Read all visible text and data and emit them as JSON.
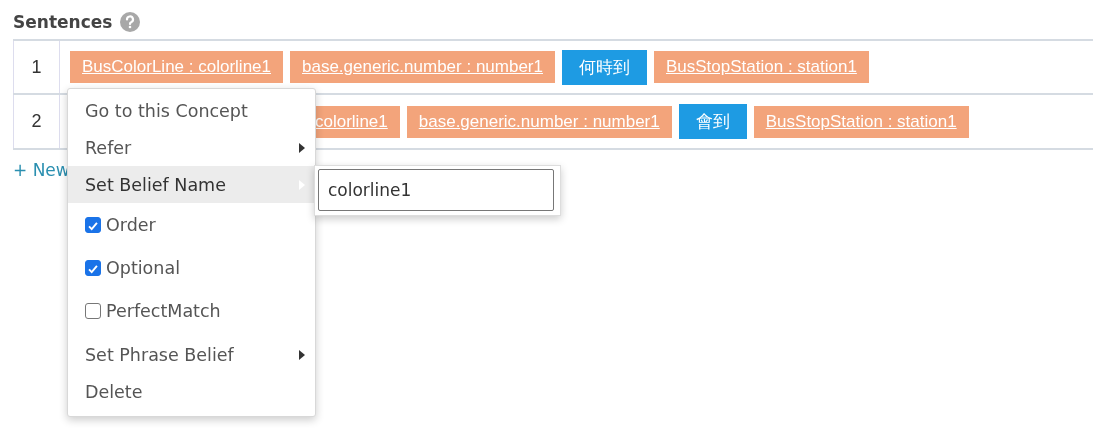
{
  "title": "Sentences",
  "rows": [
    {
      "number": "1",
      "chips": [
        {
          "kind": "concept",
          "text": "BusColorLine : colorline1"
        },
        {
          "kind": "concept",
          "text": "base.generic.number : number1"
        },
        {
          "kind": "word",
          "text": "何時到"
        },
        {
          "kind": "concept",
          "text": "BusStopStation : station1"
        }
      ]
    },
    {
      "number": "2",
      "chips": [
        {
          "kind": "concept",
          "text": "colorline1"
        },
        {
          "kind": "concept",
          "text": "base.generic.number : number1"
        },
        {
          "kind": "word",
          "text": "會到"
        },
        {
          "kind": "concept",
          "text": "BusStopStation : station1"
        }
      ]
    }
  ],
  "new_link": "+ New",
  "context_menu": {
    "items": [
      {
        "kind": "action",
        "label": "Go to this Concept",
        "selected": false
      },
      {
        "kind": "submenu",
        "label": "Refer",
        "selected": false
      },
      {
        "kind": "submenu",
        "label": "Set Belief Name",
        "selected": true
      },
      {
        "kind": "checkbox",
        "label": "Order",
        "checked": true,
        "selected": false
      },
      {
        "kind": "checkbox",
        "label": "Optional",
        "checked": true,
        "selected": false
      },
      {
        "kind": "checkbox",
        "label": "PerfectMatch",
        "checked": false,
        "selected": false
      },
      {
        "kind": "submenu",
        "label": "Set Phrase Belief",
        "selected": false
      },
      {
        "kind": "action",
        "label": "Delete",
        "selected": false
      }
    ]
  },
  "belief_name_field": {
    "value": "colorline1"
  }
}
